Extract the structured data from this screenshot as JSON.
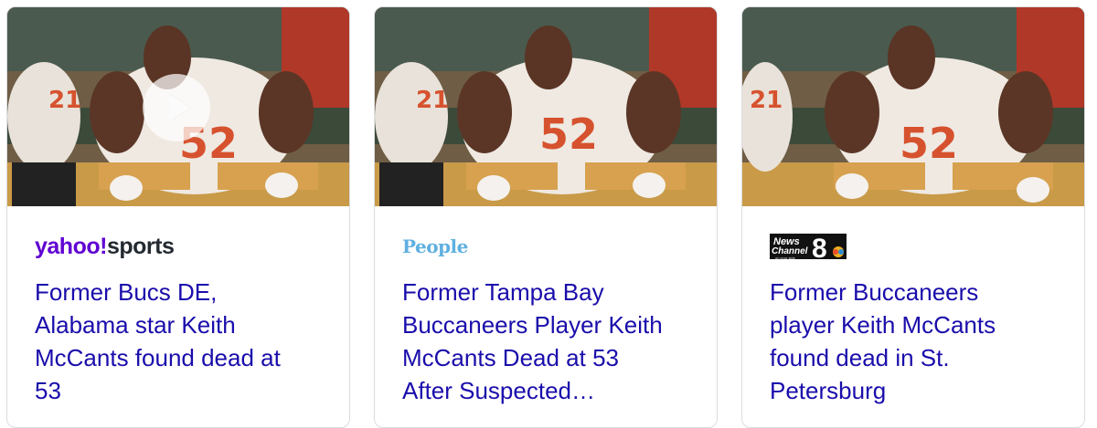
{
  "results": [
    {
      "source": "yahoo!sports",
      "source_parts": {
        "brand": "yahoo!",
        "section": "sports"
      },
      "title_lines": [
        "Former Bucs DE,",
        "Alabama star Keith",
        "McCants found dead at",
        "53"
      ],
      "has_video": true
    },
    {
      "source": "People",
      "title_lines": [
        "Former Tampa Bay",
        "Buccaneers Player Keith",
        "McCants Dead at 53",
        "After Suspected…"
      ],
      "has_video": false
    },
    {
      "source_parts": {
        "line1": "News",
        "line2": "Channel",
        "number": "8",
        "tagline": "on your side"
      },
      "title_lines": [
        "Former Buccaneers",
        "player Keith McCants",
        "found dead in St.",
        "Petersburg"
      ],
      "has_video": false
    }
  ],
  "colors": {
    "link": "#1a0dab",
    "yahoo_purple": "#6001d2",
    "people_blue": "#5fb0e0",
    "card_border": "#dadce0"
  },
  "icons": [
    "play-icon"
  ],
  "photo": {
    "jersey_number": "52",
    "sleeve_number": "21"
  }
}
